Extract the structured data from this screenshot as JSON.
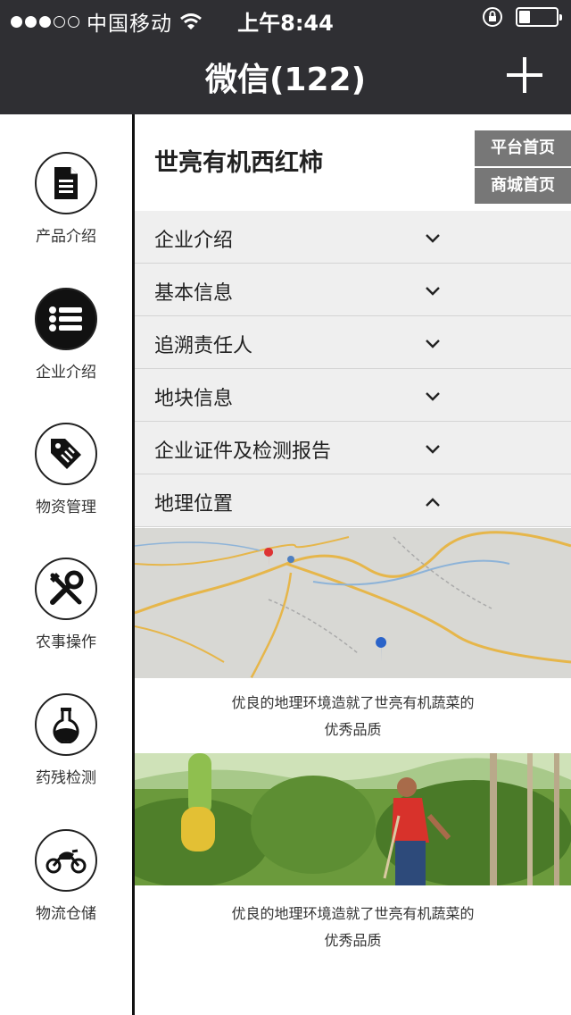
{
  "status_bar": {
    "carrier": "中国移动",
    "time": "上午8:44",
    "battery_level": 0.3
  },
  "nav": {
    "title": "微信(122)",
    "add_icon": "plus-icon"
  },
  "sidebar": {
    "items": [
      {
        "label": "产品介绍",
        "icon": "document-icon",
        "active": false
      },
      {
        "label": "企业介绍",
        "icon": "list-icon",
        "active": true
      },
      {
        "label": "物资管理",
        "icon": "tag-icon",
        "active": false
      },
      {
        "label": "农事操作",
        "icon": "tools-icon",
        "active": false
      },
      {
        "label": "药残检测",
        "icon": "flask-icon",
        "active": false
      },
      {
        "label": "物流仓储",
        "icon": "motorcycle-icon",
        "active": false
      }
    ]
  },
  "header": {
    "title": "世亮有机西红柿",
    "platform_home": "平台首页",
    "mall_home": "商城首页"
  },
  "accordion": [
    {
      "label": "企业介绍",
      "expanded": false
    },
    {
      "label": "基本信息",
      "expanded": false
    },
    {
      "label": "追溯责任人",
      "expanded": false
    },
    {
      "label": "地块信息",
      "expanded": false
    },
    {
      "label": "企业证件及检测报告",
      "expanded": false
    },
    {
      "label": "地理位置",
      "expanded": true
    }
  ],
  "sections": {
    "map_caption_line1": "优良的地理环境造就了世亮有机蔬菜的",
    "map_caption_line2": "优秀品质",
    "photo_caption_line1": "优良的地理环境造就了世亮有机蔬菜的",
    "photo_caption_line2": "优秀品质"
  },
  "colors": {
    "bar_bg": "#2f2f33",
    "accordion_bg": "#efefef",
    "top_button_bg": "#777777"
  }
}
